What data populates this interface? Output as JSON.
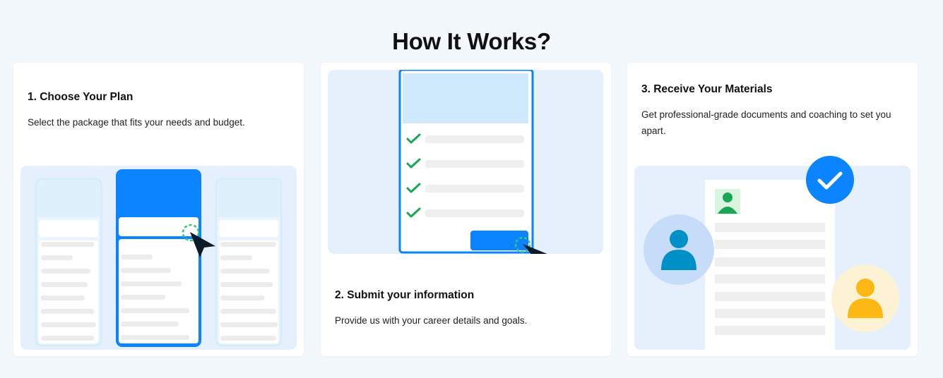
{
  "page": {
    "title": "How It Works?"
  },
  "steps": [
    {
      "title": "1. Choose Your Plan",
      "description": "Select the package that fits your needs and budget.",
      "illustration": "plan-selection-icon"
    },
    {
      "title": "2. Submit your information",
      "description": "Provide us with your career details and goals.",
      "illustration": "checklist-form-icon"
    },
    {
      "title": "3. Receive Your Materials",
      "description": "Get professional-grade documents and coaching to set you apart.",
      "illustration": "resume-document-icon"
    }
  ],
  "colors": {
    "accent_blue": "#0a84ff",
    "check_green": "#1aa653",
    "illustration_bg": "#e6f0fd",
    "person_blue": "#0090c8",
    "person_yellow": "#fdb813"
  }
}
